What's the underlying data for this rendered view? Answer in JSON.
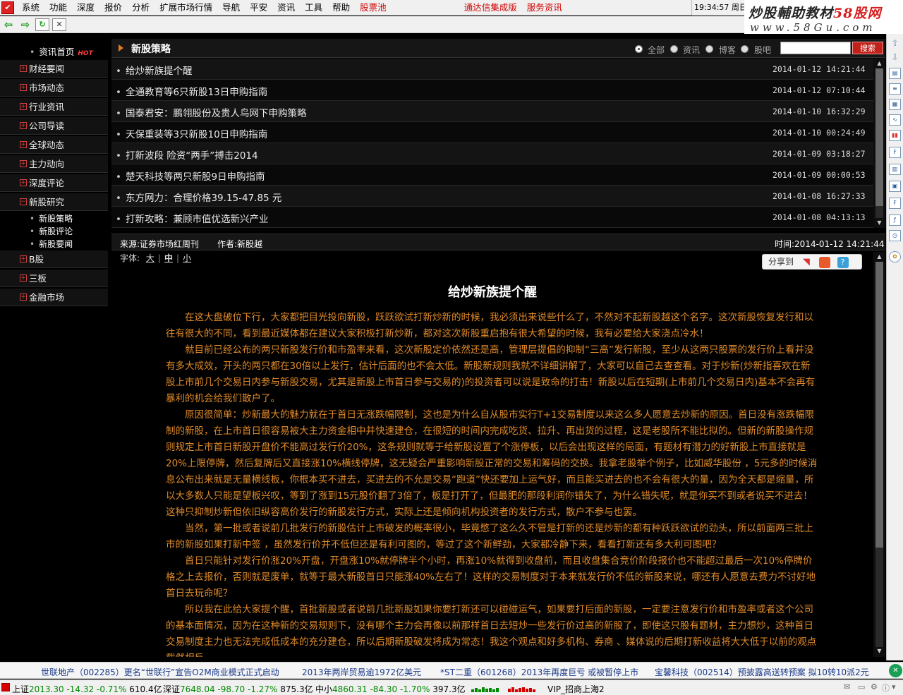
{
  "menubar": {
    "app_icon": "app-icon",
    "items": [
      "系统",
      "功能",
      "深度",
      "报价",
      "分析",
      "扩展市场行情",
      "导航",
      "平安",
      "资讯",
      "工具",
      "帮助",
      "股票池"
    ],
    "links": [
      "通达信集成版",
      "服务资讯"
    ],
    "clock": "19:34:57 周日"
  },
  "brand": {
    "line1_a": "炒股輔助教材",
    "line1_b": "58股网",
    "line2": "www.58Gu.com"
  },
  "toolbar": {
    "icons": [
      "back-arrow-icon",
      "forward-arrow-icon",
      "refresh-icon",
      "close-icon"
    ]
  },
  "sidebar": {
    "home": "资讯首页",
    "home_badge": "HOT",
    "categories": [
      "财经要闻",
      "市场动态",
      "行业资讯",
      "公司导读",
      "全球动态",
      "主力动向",
      "深度评论",
      "新股研究",
      "B股",
      "三板",
      "金融市场"
    ],
    "sub_items": [
      "新股策略",
      "新股评论",
      "新股要闻"
    ]
  },
  "section": {
    "title": "新股策略",
    "filters": [
      "全部",
      "资讯",
      "博客",
      "股吧"
    ],
    "search_placeholder": "",
    "search_label": "搜索"
  },
  "news": [
    {
      "title": "给炒新族提个醒",
      "time": "2014-01-12 14:21:44"
    },
    {
      "title": "全通教育等6只新股13日申购指南",
      "time": "2014-01-12 07:10:44"
    },
    {
      "title": "国泰君安：鹏翎股份及贵人鸟网下申购策略",
      "time": "2014-01-10 16:32:29"
    },
    {
      "title": "天保重装等3只新股10日申购指南",
      "time": "2014-01-10 00:24:49"
    },
    {
      "title": "打新波段 险资“两手”搏击2014",
      "time": "2014-01-09 03:18:27"
    },
    {
      "title": "楚天科技等两只新股9日申购指南",
      "time": "2014-01-09 00:00:53"
    },
    {
      "title": "东方网力：合理价格39.15-47.85 元",
      "time": "2014-01-08 16:27:33"
    },
    {
      "title": "打新攻略：兼顾市值优选新兴产业",
      "time": "2014-01-08 04:13:13"
    }
  ],
  "article": {
    "source": "来源:证券市场红周刊",
    "author": "作者:新股越",
    "time": "时间:2014-01-12 14:21:44",
    "font_label": "字体:",
    "font_sizes": [
      "大",
      "中",
      "小"
    ],
    "share_label": "分享到",
    "title": "给炒新族提个醒",
    "paragraphs": [
      "在这大盘破位下行，大家都把目光投向新股，跃跃欲试打新炒新的时候，我必须出来说些什么了，不然对不起新股越这个名字。这次新股恢复发行和以往有很大的不同，看到最近媒体都在建议大家积极打新炒新，都对这次新股重启抱有很大希望的时候，我有必要给大家浇点冷水！",
      "就目前已经公布的两只新股发行价和市盈率来看，这次新股定价依然还是高，管理层提倡的抑制“三高”发行新股，至少从这两只股票的发行价上看并没有多大成效，开头的两只都在30倍以上发行，估计后面的也不会太低。新股新规则我就不详细讲解了，大家可以自己去查查看。对于炒新(炒新指喜欢在新股上市前几个交易日内参与新股交易，尤其是新股上市首日参与交易的)的投资者可以说是致命的打击！新股以后在短期(上市前几个交易日内)基本不会再有暴利的机会给我们散户了。",
      "原因很简单：炒新最大的魅力就在于首日无涨跌幅限制，这也是为什么自从股市实行T+1交易制度以来这么多人愿意去炒新的原因。首日没有涨跌幅限制的新股，在上市首日很容易被大主力资金相中并快速建仓，在很短的时间内完成吃货、拉升、再出货的过程，这是老股所不能比拟的。但新的新股操作规则规定上市首日新股开盘价不能高过发行价20%，这条规则就等于给新股设置了个涨停板，以后会出现这样的局面，有题材有潜力的好新股上市直接就是20%上限停牌，然后复牌后又直接涨10%横线停牌，这无疑会严重影响新股正常的交易和筹码的交换。我拿老股举个例子，比如威华股份 ，5元多的时候消息公布出来就是无量横线板，你根本买不进去，买进去的不允是交易“跑道”快还要加上运气好，而且能买进去的也不会有很大的量，因为全天都是缩量，所以大多数人只能是望板兴叹，等到了涨到15元股价翻了3倍了，板是打开了，但最肥的那段利润你错失了，为什么错失呢，就是你买不到或者说买不进去！这种只抑制炒新但依旧纵容高价发行的新股发行方式，实际上还是倾向机构投资者的发行方式，散户不参与也罢。",
      "当然，第一批或者说前几批发行的新股估计上市破发的概率很小，毕竟憋了这么久不管是打新的还是炒新的都有种跃跃欲试的劲头，所以前面两三批上市的新股如果打新中签 ，虽然发行价并不低但还是有利可图的，等过了这个新鲜劲，大家都冷静下来，看看打新还有多大利可图吧？",
      "首日只能针对发行价涨20%开盘，开盘涨10%就停牌半个小时，再涨10%就得到收盘前，而且收盘集合竞价阶段报价也不能超过最后一次10%停牌价格之上去报价，否则就是废单，就等于最大新股首日只能涨40%左右了！这样的交易制度对于本来就发行价不低的新股来说，哪还有人愿意去费力不讨好地首日去玩命呢？",
      "所以我在此给大家提个醒，首批新股或者说前几批新股如果你要打新还可以碰碰运气，如果要打后面的新股，一定要注意发行价和市盈率或者这个公司的基本面情况，因为在这种新的交易规则下，没有哪个主力会再像以前那样首日去短炒一些发行价过高的新股了，即使这只股有题材，主力想炒，这种首日交易制度主力也无法完成低成本的充分建仓，所以后期新股破发将成为常态！我这个观点和好多机构、券商 、媒体说的后期打新收益将大大低于以前的观点截然相反。"
    ]
  },
  "right_bar": {
    "icons": [
      "up-arrow-icon",
      "down-arrow-icon",
      "chart-icon",
      "list-icon",
      "grid-icon",
      "line-chart-icon",
      "bar-chart-icon",
      "info-icon",
      "table-icon",
      "doc-icon",
      "fund-icon",
      "clock-icon",
      "gear-icon"
    ]
  },
  "ticker": [
    "世联地产（002285）更名“世联行”宣告O2M商业模式正式启动",
    "2013年两岸贸易逾1972亿美元",
    "*ST二重（601268）2013年再度巨亏 或被暂停上市",
    "宝馨科技（002514）预披露高送转预案 拟10转10派2元"
  ],
  "status": {
    "indices": [
      {
        "name": "上证",
        "price": "2013.30",
        "change": "-14.32",
        "pct": "-0.71%",
        "vol": "610.4亿"
      },
      {
        "name": "深证",
        "price": "7648.04",
        "change": "-98.70",
        "pct": "-1.27%",
        "vol": "875.3亿"
      },
      {
        "name": "中小",
        "price": "4860.31",
        "change": "-84.30",
        "pct": "-1.70%",
        "vol": "397.3亿"
      }
    ],
    "vip": "VIP_招商上海2"
  }
}
